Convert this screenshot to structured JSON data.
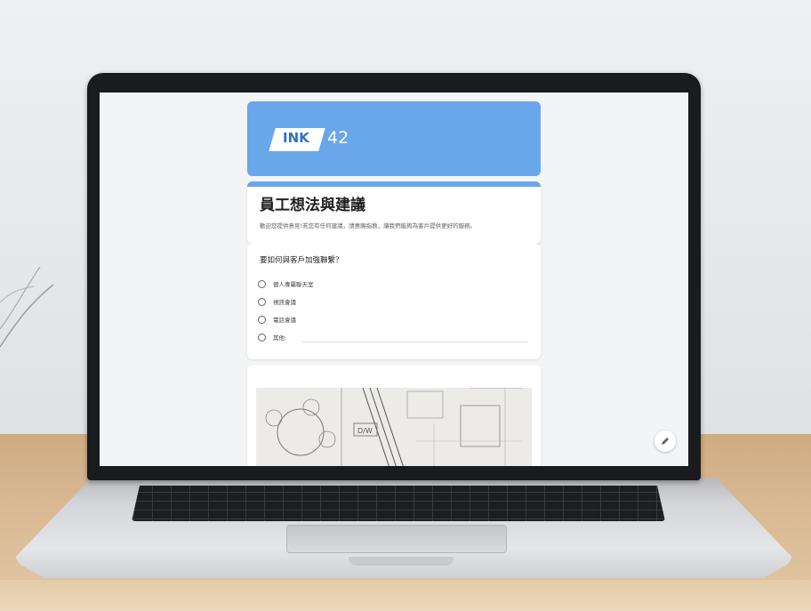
{
  "banner": {
    "logo_text": "INK",
    "logo_number": "42",
    "color": "#6aa6ea"
  },
  "form": {
    "title": "員工想法與建議",
    "description": "歡迎您提供意見!若您有任何建議，請惠賜指教，讓我們能夠為客戶提供更好的服務。"
  },
  "question": {
    "title": "要如何與客戶加強聯繫？",
    "options": [
      "個人專屬聯天室",
      "視訊會議",
      "電話會議",
      "其他:"
    ]
  },
  "image_card": {
    "icon": "blueprint-image"
  },
  "fab": {
    "icon": "pencil-icon"
  }
}
